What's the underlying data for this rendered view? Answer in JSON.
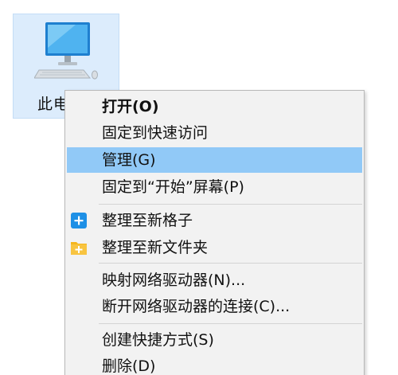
{
  "desktop": {
    "icon_label": "此电"
  },
  "context_menu": {
    "items": [
      {
        "label": "打开(O)",
        "bold": true
      },
      {
        "label": "固定到快速访问"
      },
      {
        "label": "管理(G)",
        "highlighted": true
      },
      {
        "label": "固定到“开始”屏幕(P)"
      },
      {
        "label": "整理至新格子",
        "icon": "blue-plus-icon"
      },
      {
        "label": "整理至新文件夹",
        "icon": "folder-plus-icon"
      },
      {
        "label": "映射网络驱动器(N)..."
      },
      {
        "label": "断开网络驱动器的连接(C)..."
      },
      {
        "label": "创建快捷方式(S)"
      },
      {
        "label": "删除(D)"
      }
    ]
  },
  "colors": {
    "highlight": "#91c9f7",
    "menu_background": "#f2f2f2",
    "icon_selection": "#dcecfc",
    "blue_icon": "#1e90e6",
    "folder_icon": "#f5b61d"
  }
}
